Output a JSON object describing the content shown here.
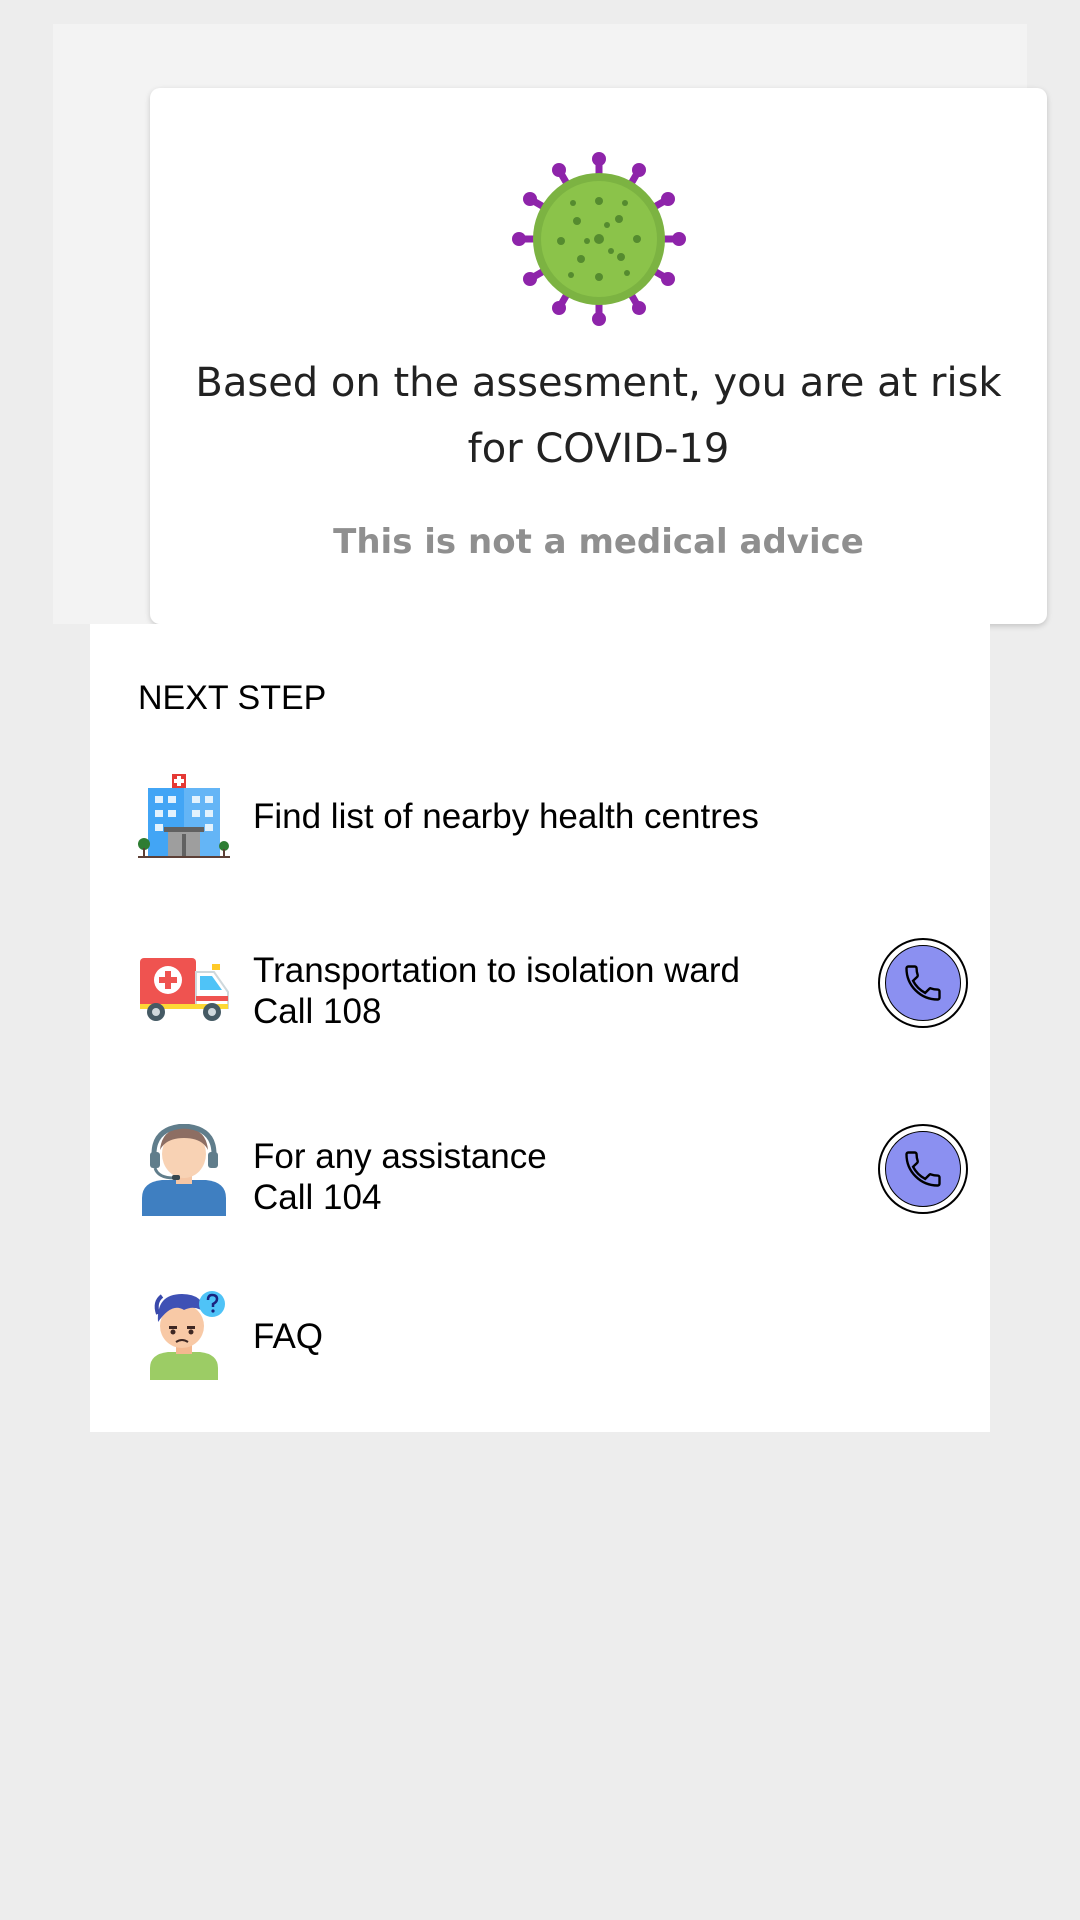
{
  "result": {
    "icon": "virus-icon",
    "message": "Based on the assesment, you are at risk for COVID-19",
    "disclaimer": "This is not a medical advice"
  },
  "next_steps": {
    "heading": "NEXT STEP",
    "items": [
      {
        "icon": "hospital-icon",
        "line1": "Find list of nearby health centres"
      },
      {
        "icon": "ambulance-icon",
        "line1": "Transportation to isolation ward",
        "line2": "Call 108",
        "action_icon": "phone-icon"
      },
      {
        "icon": "support-agent-icon",
        "line1": "For any assistance",
        "line2": "Call 104",
        "action_icon": "phone-icon"
      },
      {
        "icon": "confused-person-icon",
        "line1": "FAQ"
      }
    ]
  },
  "colors": {
    "page_background": "#ededed",
    "call_button": "#8b90f1",
    "virus_green": "#8bc34a",
    "virus_spike": "#9c27b0",
    "disclaimer_text": "#8f8f8f"
  }
}
